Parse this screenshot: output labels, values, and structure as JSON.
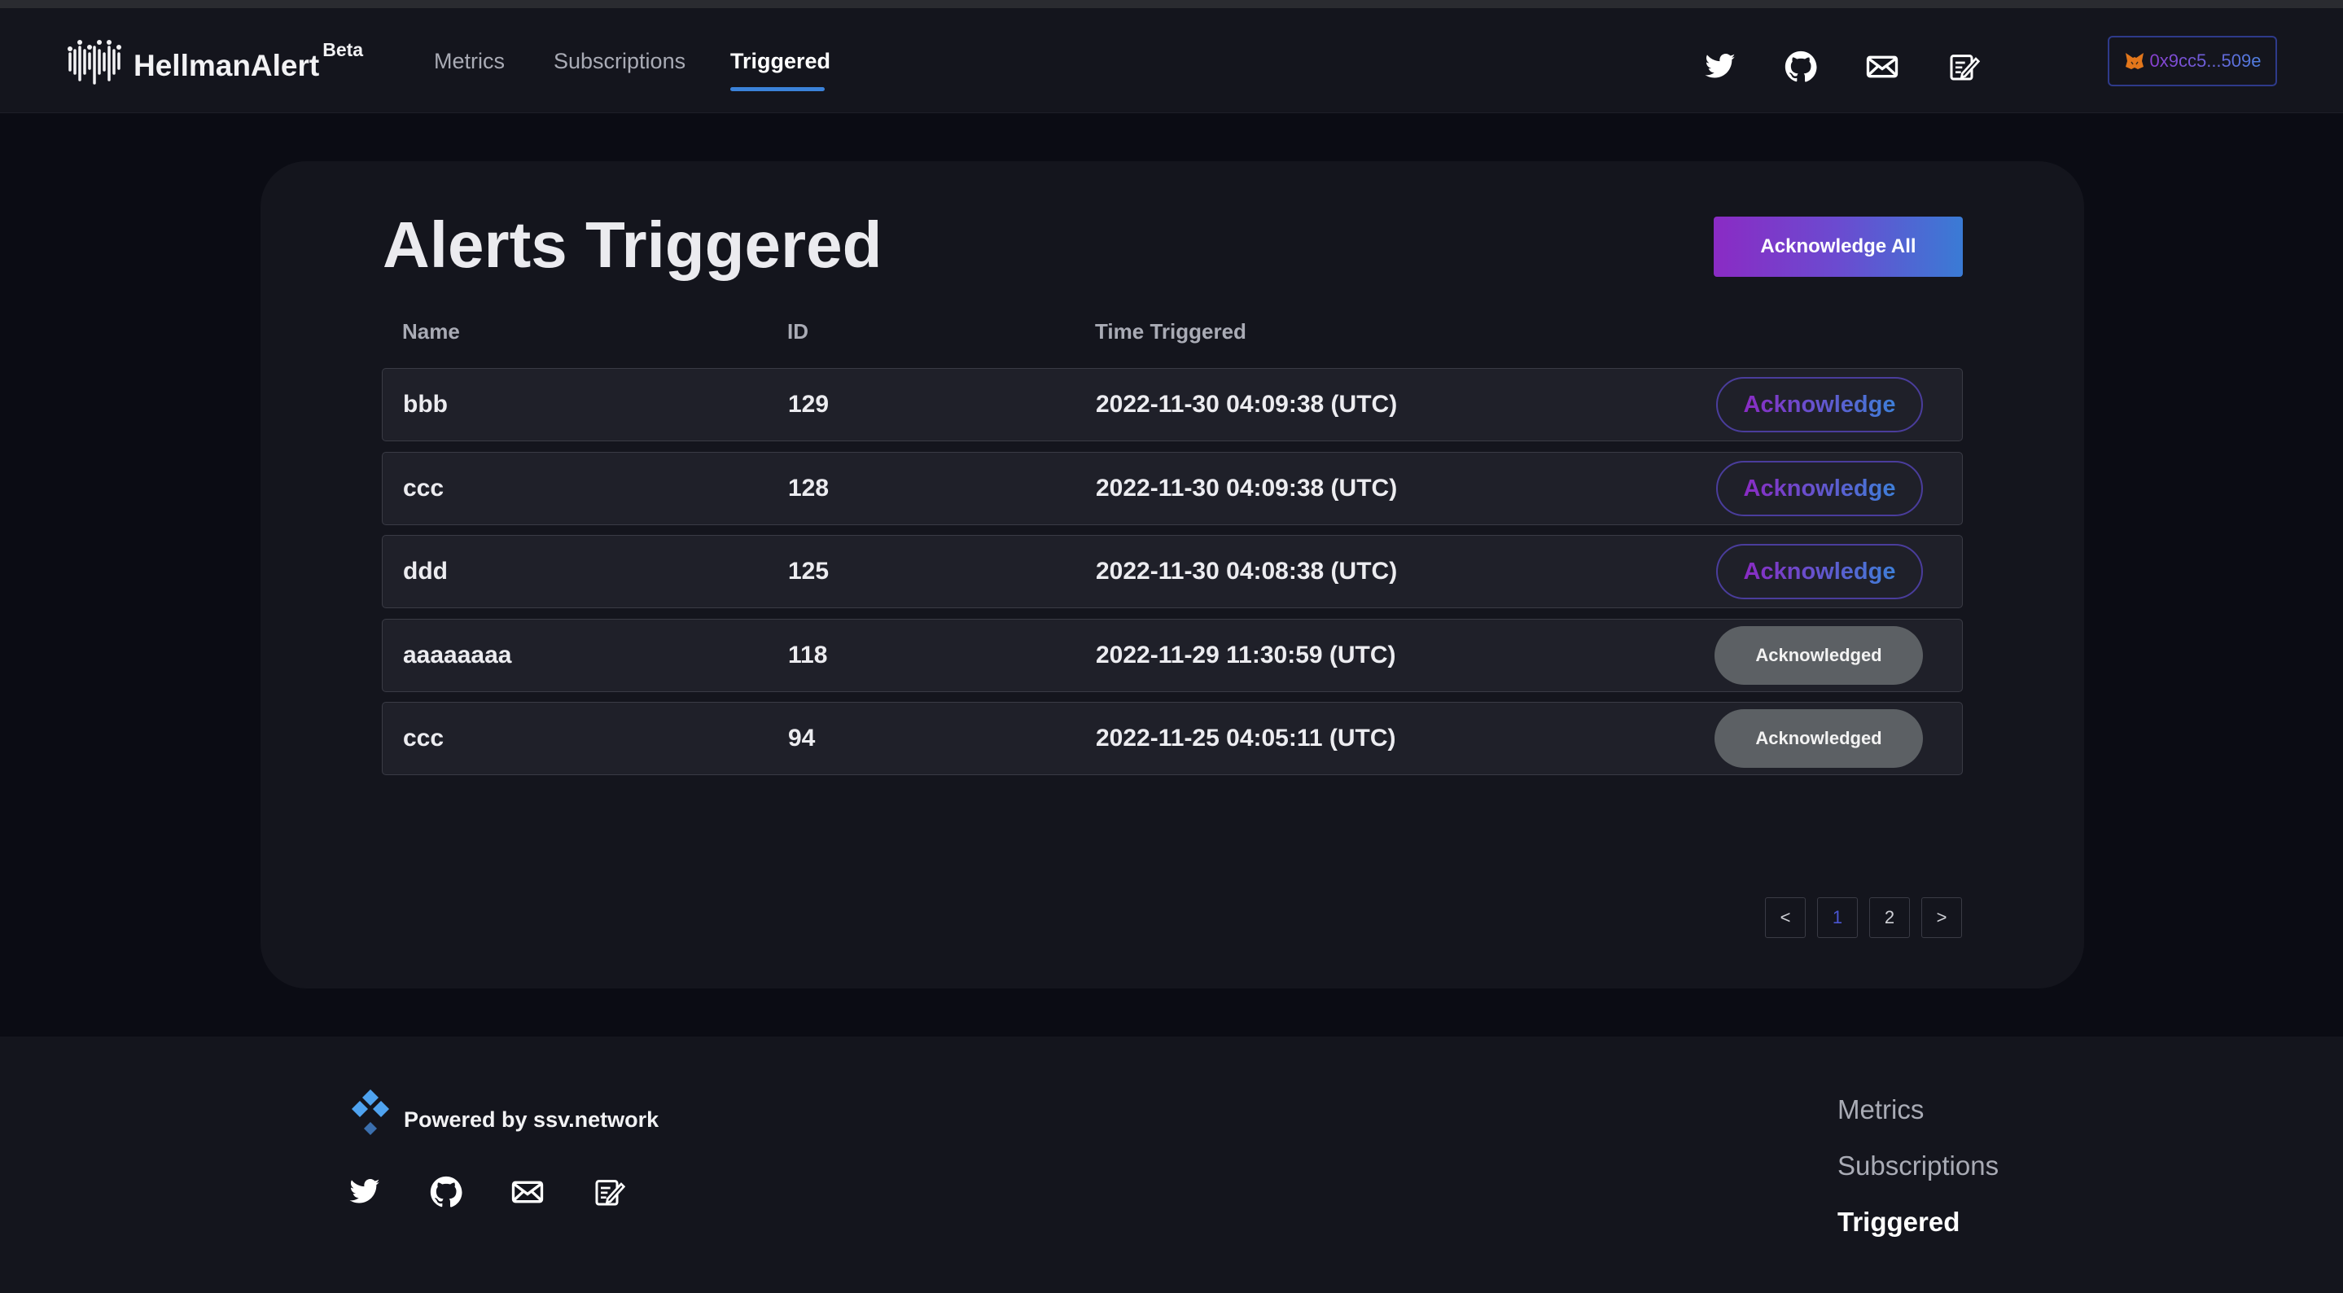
{
  "header": {
    "logo_text": "HellmanAlert",
    "beta_label": "Beta",
    "nav": [
      {
        "label": "Metrics"
      },
      {
        "label": "Subscriptions"
      },
      {
        "label": "Triggered",
        "active": true
      }
    ],
    "social_icons": [
      "twitter-icon",
      "github-icon",
      "mail-icon",
      "notes-icon"
    ],
    "wallet_address": "0x9cc5...509e",
    "wallet_icon": "fox-icon"
  },
  "main": {
    "title": "Alerts Triggered",
    "acknowledge_all_label": "Acknowledge All",
    "columns": [
      "Name",
      "ID",
      "Time Triggered"
    ],
    "rows": [
      {
        "name": "bbb",
        "id": "129",
        "time": "2022-11-30 04:09:38 (UTC)",
        "action": "Acknowledge",
        "acknowledged": false
      },
      {
        "name": "ccc",
        "id": "128",
        "time": "2022-11-30 04:09:38 (UTC)",
        "action": "Acknowledge",
        "acknowledged": false
      },
      {
        "name": "ddd",
        "id": "125",
        "time": "2022-11-30 04:08:38 (UTC)",
        "action": "Acknowledge",
        "acknowledged": false
      },
      {
        "name": "aaaaaaaa",
        "id": "118",
        "time": "2022-11-29 11:30:59 (UTC)",
        "action": "Acknowledged",
        "acknowledged": true
      },
      {
        "name": "ccc",
        "id": "94",
        "time": "2022-11-25 04:05:11 (UTC)",
        "action": "Acknowledged",
        "acknowledged": true
      }
    ],
    "pagination": {
      "prev": "<",
      "pages": [
        "1",
        "2"
      ],
      "current": "1",
      "next": ">"
    }
  },
  "footer": {
    "powered_by": "Powered by ssv.network",
    "social_icons": [
      "twitter-icon",
      "github-icon",
      "mail-icon",
      "notes-icon"
    ],
    "nav": [
      {
        "label": "Metrics"
      },
      {
        "label": "Subscriptions"
      },
      {
        "label": "Triggered",
        "active": true
      }
    ]
  },
  "colors": {
    "background": "#0b0c14",
    "surface": "#14151d",
    "row": "#1f2029",
    "accent_purple": "#8a2bc4",
    "accent_blue": "#3a7bd5",
    "acknowledged_gray": "#5c6064"
  }
}
